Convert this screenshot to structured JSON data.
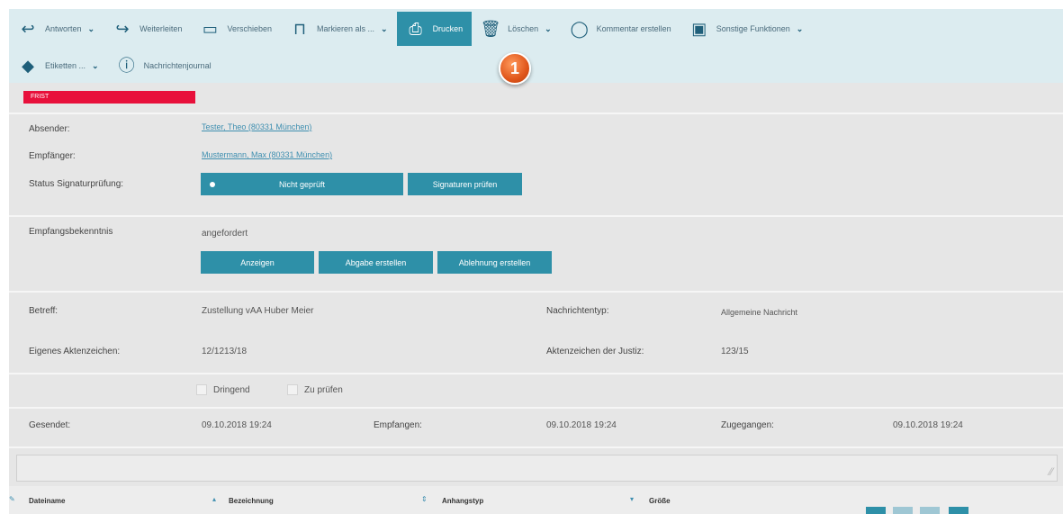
{
  "toolbar": {
    "row1": [
      {
        "label": "Antworten",
        "icon": "reply-icon",
        "glyph": "↩",
        "dropdown": true,
        "active": false
      },
      {
        "label": "Weiterleiten",
        "icon": "forward-icon",
        "glyph": "↪",
        "dropdown": false,
        "active": false
      },
      {
        "label": "Verschieben",
        "icon": "folder-icon",
        "glyph": "▭",
        "dropdown": false,
        "active": false
      },
      {
        "label": "Markieren als ...",
        "icon": "bookmark-icon",
        "glyph": "⊓",
        "dropdown": true,
        "active": false
      },
      {
        "label": "Drucken",
        "icon": "printer-icon",
        "glyph": "⎙",
        "dropdown": false,
        "active": true
      },
      {
        "label": "Löschen",
        "icon": "trash-icon",
        "glyph": "🗑",
        "dropdown": true,
        "active": false
      },
      {
        "label": "Kommentar erstellen",
        "icon": "comment-icon",
        "glyph": "◯",
        "dropdown": false,
        "active": false
      },
      {
        "label": "Sonstige Funktionen",
        "icon": "menu-box-icon",
        "glyph": "▣",
        "dropdown": true,
        "active": false
      }
    ],
    "row2": [
      {
        "label": "Etiketten ...",
        "icon": "tag-icon",
        "glyph": "◆",
        "dropdown": true,
        "active": false
      },
      {
        "label": "Nachrichtenjournal",
        "icon": "info-icon",
        "glyph": "ⓘ",
        "dropdown": false,
        "active": false
      }
    ],
    "chevron": "⌄"
  },
  "callout": "1",
  "frist": "FRIST",
  "header": {
    "sender_label": "Absender:",
    "sender_value": "Tester, Theo (80331 München)",
    "recipient_label": "Empfänger:",
    "recipient_value": "Mustermann, Max (80331 München)",
    "signature_label": "Status Signaturprüfung:",
    "signature_status": "Nicht geprüft",
    "signature_check": "Signaturen prüfen"
  },
  "receipt": {
    "label": "Empfangsbekenntnis",
    "value": "angefordert",
    "buttons": [
      "Anzeigen",
      "Abgabe erstellen",
      "Ablehnung erstellen"
    ]
  },
  "details": {
    "subject_label": "Betreff:",
    "subject_value": "Zustellung vAA Huber Meier",
    "msgtype_label": "Nachrichtentyp:",
    "msgtype_value": "Allgemeine Nachricht",
    "own_ref_label": "Eigenes Aktenzeichen:",
    "own_ref_value": "12/1213/18",
    "court_ref_label": "Aktenzeichen der Justiz:",
    "court_ref_value": "123/15"
  },
  "flags": {
    "urgent": "Dringend",
    "to_check": "Zu prüfen"
  },
  "times": {
    "sent_label": "Gesendet:",
    "sent_value": "09.10.2018 19:24",
    "received_label": "Empfangen:",
    "received_value": "09.10.2018 19:24",
    "delivered_label": "Zugegangen:",
    "delivered_value": "09.10.2018 19:24"
  },
  "comment_grip": "⁄⁄",
  "attachments": {
    "columns": [
      "Dateiname",
      "Bezeichnung",
      "Anhangstyp",
      "Größe"
    ],
    "sort_glyphs": [
      "▴",
      "⇕",
      "▾"
    ]
  }
}
